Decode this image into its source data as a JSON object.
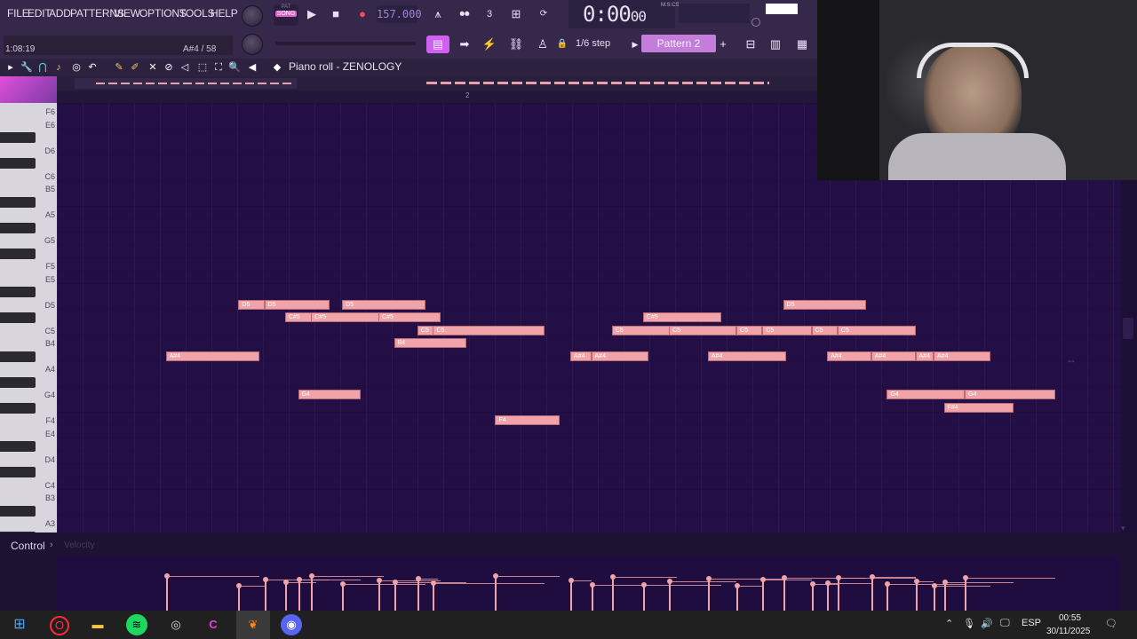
{
  "menu": [
    "FILE",
    "EDIT",
    "ADD",
    "PATTERNS",
    "VIEW",
    "OPTIONS",
    "TOOLS",
    "HELP"
  ],
  "hint": {
    "time": "1:08:19",
    "note": "A#4 / 58"
  },
  "transport": {
    "pat_label": "PAT",
    "song_label": "SONG",
    "tempo": "157.000",
    "time": "0:00",
    "time_sub": "00",
    "time_mode": "M:S:CS"
  },
  "row2": {
    "step": "1/6 step",
    "pattern": "Pattern 2",
    "add": "+"
  },
  "pianoroll": {
    "title": "Piano roll - ZENOLOGY",
    "ruler_mark": "2"
  },
  "keyboard_labels": [
    {
      "t": "F6"
    },
    {
      "t": "E6"
    },
    {
      "t": "D6"
    },
    {
      "t": "C6"
    },
    {
      "t": "B5"
    },
    {
      "t": "A5"
    },
    {
      "t": "G5"
    },
    {
      "t": "F5"
    },
    {
      "t": "E5"
    },
    {
      "t": "D5"
    },
    {
      "t": "C5"
    },
    {
      "t": "B4"
    },
    {
      "t": "A4"
    },
    {
      "t": "G4"
    },
    {
      "t": "F4"
    },
    {
      "t": "E4"
    },
    {
      "t": "D4"
    },
    {
      "t": "C4"
    },
    {
      "t": "B3"
    },
    {
      "t": "A3"
    }
  ],
  "notes": [
    {
      "pitch": "D5",
      "label": "D5",
      "start": 7.0,
      "len": 1.0
    },
    {
      "pitch": "D5",
      "label": "D5",
      "start": 8.0,
      "len": 2.5
    },
    {
      "pitch": "D5",
      "label": "D5",
      "start": 11.0,
      "len": 3.2
    },
    {
      "pitch": "D5",
      "label": "D5",
      "start": 28.0,
      "len": 3.2
    },
    {
      "pitch": "C#5",
      "label": "C#5",
      "start": 8.8,
      "len": 1.2
    },
    {
      "pitch": "C#5",
      "label": "C#5",
      "start": 9.8,
      "len": 2.8
    },
    {
      "pitch": "C#5",
      "label": "C#5",
      "start": 12.4,
      "len": 2.4
    },
    {
      "pitch": "C#5",
      "label": "C#5",
      "start": 22.6,
      "len": 3.0
    },
    {
      "pitch": "C5",
      "label": "C5",
      "start": 13.9,
      "len": 0.8
    },
    {
      "pitch": "C5",
      "label": "C5",
      "start": 14.5,
      "len": 4.3
    },
    {
      "pitch": "C5",
      "label": "C5",
      "start": 21.4,
      "len": 2.5
    },
    {
      "pitch": "C5",
      "label": "C5",
      "start": 23.6,
      "len": 2.6
    },
    {
      "pitch": "C5",
      "label": "C5",
      "start": 26.2,
      "len": 1.0
    },
    {
      "pitch": "C5",
      "label": "C5",
      "start": 27.2,
      "len": 1.9
    },
    {
      "pitch": "C5",
      "label": "C5",
      "start": 29.1,
      "len": 1.0
    },
    {
      "pitch": "C5",
      "label": "C5",
      "start": 30.1,
      "len": 3.0
    },
    {
      "pitch": "B4",
      "label": "B4",
      "start": 13.0,
      "len": 2.8
    },
    {
      "pitch": "A#4",
      "label": "A#4",
      "start": 4.2,
      "len": 3.6
    },
    {
      "pitch": "A#4",
      "label": "A#4",
      "start": 19.8,
      "len": 0.8
    },
    {
      "pitch": "A#4",
      "label": "A#4",
      "start": 20.6,
      "len": 2.2
    },
    {
      "pitch": "A#4",
      "label": "A#4",
      "start": 25.1,
      "len": 3.0
    },
    {
      "pitch": "A#4",
      "label": "A#4",
      "start": 29.7,
      "len": 1.7
    },
    {
      "pitch": "A#4",
      "label": "A#4",
      "start": 31.4,
      "len": 1.7
    },
    {
      "pitch": "A#4",
      "label": "A#4",
      "start": 33.1,
      "len": 0.7
    },
    {
      "pitch": "A#4",
      "label": "A#4",
      "start": 33.8,
      "len": 2.2
    },
    {
      "pitch": "G4",
      "label": "G4",
      "start": 9.3,
      "len": 2.4
    },
    {
      "pitch": "G4",
      "label": "G4",
      "start": 32.0,
      "len": 3.0
    },
    {
      "pitch": "G4",
      "label": "G4",
      "start": 35.0,
      "len": 3.5
    },
    {
      "pitch": "F#4",
      "label": "F#4",
      "start": 34.2,
      "len": 2.7
    },
    {
      "pitch": "F4",
      "label": "F4",
      "start": 16.9,
      "len": 2.5
    }
  ],
  "control": {
    "label": "Control",
    "arrow": "›",
    "param": "Velocity"
  },
  "taskbar": {
    "lang": "ESP",
    "time": "00:55",
    "date": "30/11/2025"
  }
}
